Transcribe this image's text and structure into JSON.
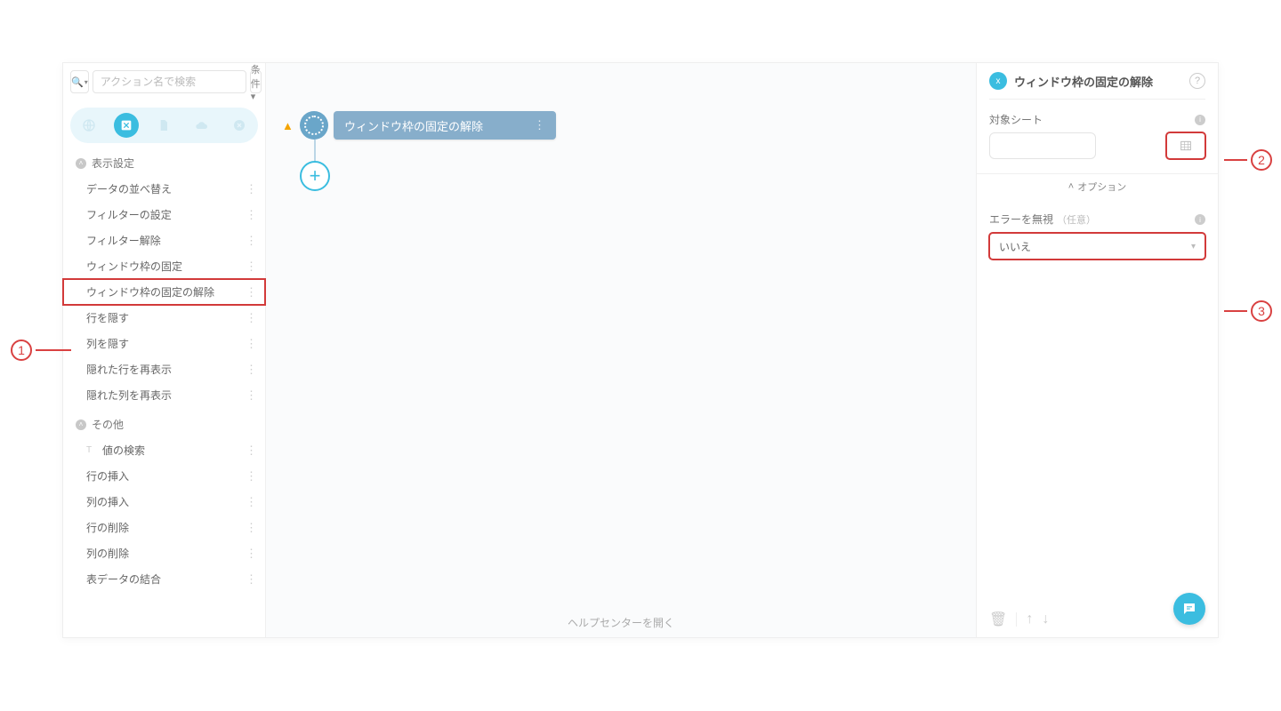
{
  "search": {
    "placeholder": "アクション名で検索",
    "condition_label": "条件 ▾"
  },
  "sidebar": {
    "groups": [
      {
        "title": "表示設定",
        "items": [
          {
            "label": "データの並べ替え"
          },
          {
            "label": "フィルターの設定"
          },
          {
            "label": "フィルター解除"
          },
          {
            "label": "ウィンドウ枠の固定"
          },
          {
            "label": "ウィンドウ枠の固定の解除",
            "highlight": true
          },
          {
            "label": "行を隠す"
          },
          {
            "label": "列を隠す"
          },
          {
            "label": "隠れた行を再表示"
          },
          {
            "label": "隠れた列を再表示"
          }
        ]
      },
      {
        "title": "その他",
        "items": [
          {
            "label": "値の検索",
            "icon": "T"
          },
          {
            "label": "行の挿入"
          },
          {
            "label": "列の挿入"
          },
          {
            "label": "行の削除"
          },
          {
            "label": "列の削除"
          },
          {
            "label": "表データの結合"
          }
        ]
      }
    ]
  },
  "canvas": {
    "node_label": "ウィンドウ枠の固定の解除",
    "help_link": "ヘルプセンターを開く"
  },
  "right_panel": {
    "title": "ウィンドウ枠の固定の解除",
    "field_sheet_label": "対象シート",
    "options_header": "オプション",
    "field_error_label": "エラーを無視",
    "field_error_optional": "（任意）",
    "error_value": "いいえ"
  },
  "callouts": {
    "c1": "1",
    "c2": "2",
    "c3": "3"
  }
}
